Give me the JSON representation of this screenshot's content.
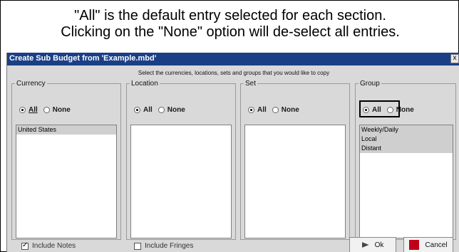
{
  "caption": {
    "line1": "\"All\" is the default entry selected for each section.",
    "line2": "Clicking on the \"None\" option will de-select all entries."
  },
  "dialog": {
    "title": "Create Sub Budget from 'Example.mbd'",
    "close_symbol": "x",
    "instruction": "Select the currencies, locations, sets and groups that you would like to copy"
  },
  "sections": {
    "currency": {
      "label": "Currency",
      "all": "All",
      "none": "None",
      "selected": "All",
      "items": [
        "United States"
      ]
    },
    "location": {
      "label": "Location",
      "all": "All",
      "none": "None",
      "selected": "All",
      "items": []
    },
    "set": {
      "label": "Set",
      "all": "All",
      "none": "None",
      "selected": "All",
      "items": []
    },
    "group": {
      "label": "Group",
      "all": "All",
      "none": "None",
      "selected": "All",
      "items": [
        "Weekly/Daily",
        "Local",
        "Distant"
      ]
    }
  },
  "footer": {
    "include_notes": {
      "label": "Include Notes",
      "checked": true
    },
    "include_fringes": {
      "label": "Include Fringes",
      "checked": false
    },
    "ok_label": "Ok",
    "cancel_label": "Cancel"
  },
  "colors": {
    "titlebar": "#1b3f86",
    "dialog_bg": "#d9d9d9",
    "selected_item_bg": "#cfcfcf",
    "cancel_icon": "#c0001a"
  }
}
